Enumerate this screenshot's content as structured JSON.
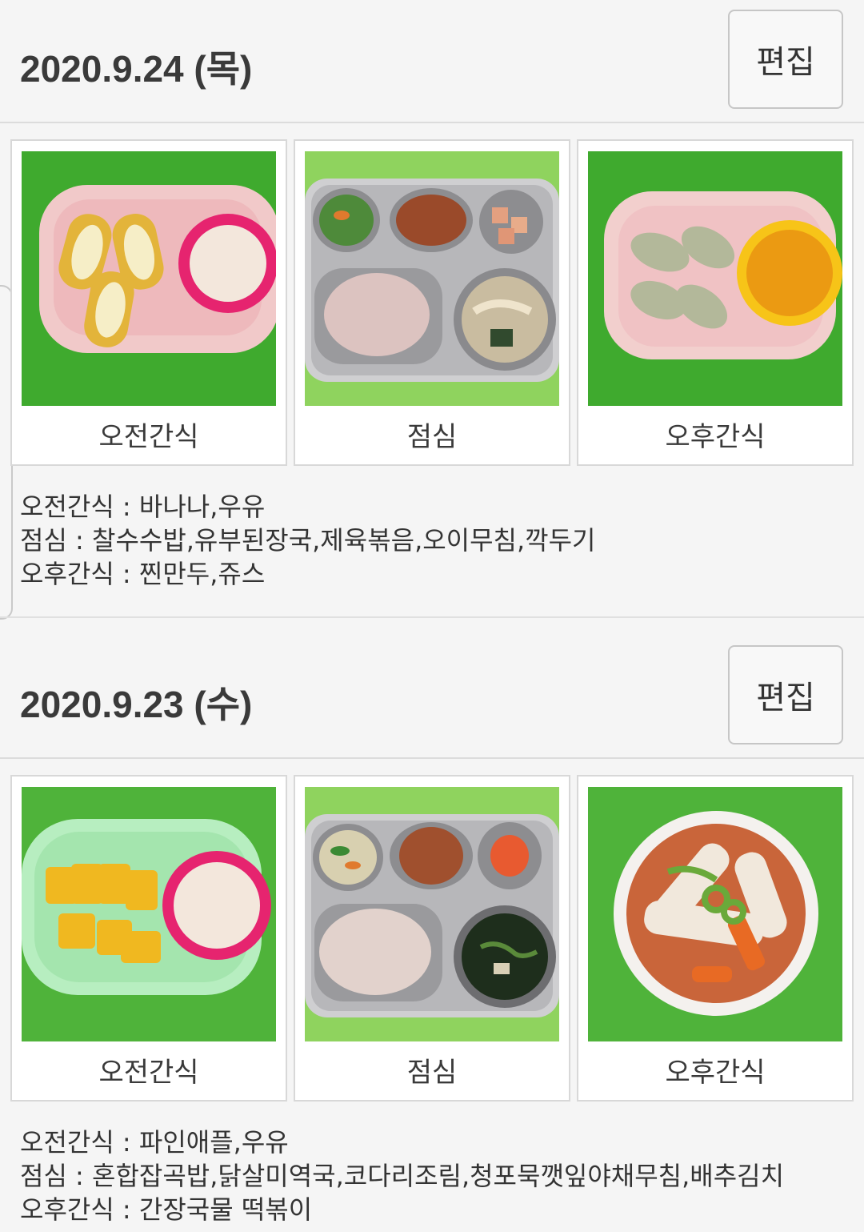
{
  "days": [
    {
      "date": "2020.9.24 (목)",
      "edit_label": "편집",
      "meals": [
        {
          "label": "오전간식",
          "photo": "banana-milk-photo"
        },
        {
          "label": "점심",
          "photo": "lunch-tray-photo"
        },
        {
          "label": "오후간식",
          "photo": "dumpling-juice-photo"
        }
      ],
      "menu": [
        "오전간식 : 바나나,우유",
        "점심 : 찰수수밥,유부된장국,제육볶음,오이무침,깍두기",
        "오후간식 : 찐만두,쥬스"
      ]
    },
    {
      "date": "2020.9.23 (수)",
      "edit_label": "편집",
      "meals": [
        {
          "label": "오전간식",
          "photo": "pineapple-milk-photo"
        },
        {
          "label": "점심",
          "photo": "lunch-tray-photo"
        },
        {
          "label": "오후간식",
          "photo": "tteokbokki-photo"
        }
      ],
      "menu": [
        "오전간식 : 파인애플,우유",
        "점심 : 혼합잡곡밥,닭살미역국,코다리조림,청포묵깻잎야채무침,배추김치",
        "오후간식 : 간장국물 떡볶이"
      ]
    }
  ],
  "colors": {
    "background": "#f5f5f5",
    "placemat_green": "#4fb33a",
    "tray_green": "#8ad35a"
  }
}
